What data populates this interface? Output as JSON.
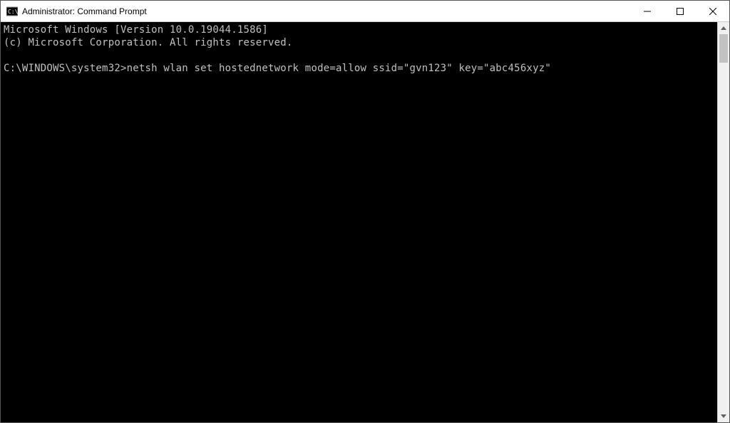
{
  "titlebar": {
    "title": "Administrator: Command Prompt"
  },
  "console": {
    "line1": "Microsoft Windows [Version 10.0.19044.1586]",
    "line2": "(c) Microsoft Corporation. All rights reserved.",
    "blank": "",
    "prompt": "C:\\WINDOWS\\system32>",
    "command": "netsh wlan set hostednetwork mode=allow ssid=\"gvn123\" key=\"abc456xyz\""
  }
}
